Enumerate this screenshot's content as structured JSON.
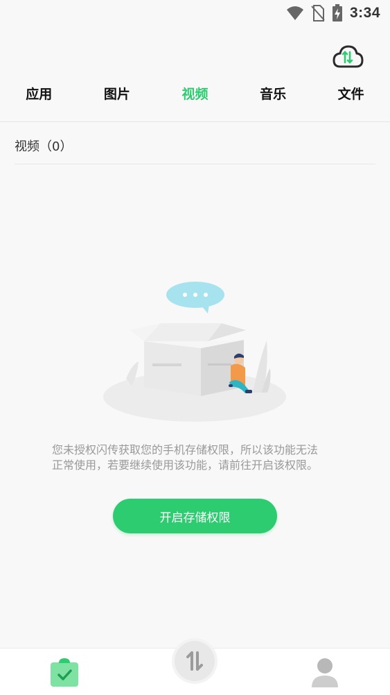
{
  "status_bar": {
    "time": "3:34",
    "icons": [
      "wifi-icon",
      "no-sim-icon",
      "battery-charging-icon"
    ]
  },
  "header": {
    "cloud_button_icon": "cloud-transfer-icon",
    "tabs": [
      {
        "label": "应用",
        "active": false
      },
      {
        "label": "图片",
        "active": false
      },
      {
        "label": "视频",
        "active": true
      },
      {
        "label": "音乐",
        "active": false
      },
      {
        "label": "文件",
        "active": false
      }
    ]
  },
  "content": {
    "section_title": "视频（0）",
    "empty_message_line1": "您未授权闪传获取您的手机存储权限，所以该功能无法",
    "empty_message_line2": "正常使用，若要继续使用该功能，请前往开启该权限。",
    "action_button": "开启存储权限"
  },
  "bottom_nav": {
    "items": [
      {
        "icon": "tasks-clipboard-icon",
        "active": true
      },
      {
        "icon": "transfer-arrows-icon",
        "active": false
      },
      {
        "icon": "profile-icon",
        "active": false
      }
    ]
  },
  "colors": {
    "accent": "#2ecc71",
    "background": "#f8f8f8",
    "text_primary": "#111111",
    "text_secondary": "#999999"
  }
}
